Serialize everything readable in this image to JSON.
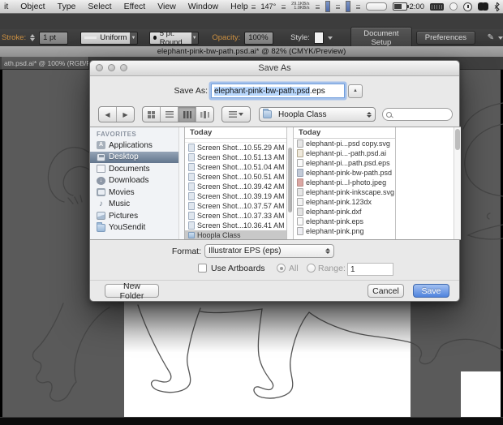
{
  "menubar": {
    "items": [
      "it",
      "Object",
      "Type",
      "Select",
      "Effect",
      "View",
      "Window",
      "Help"
    ],
    "status": {
      "temp": "147°",
      "net_up": "29.1KB/s",
      "net_down": "1.0KB/s",
      "battery_time": "2:00"
    }
  },
  "control_bar": {
    "stroke_label": "Stroke:",
    "stroke_value": "1 pt",
    "profile_value": "Uniform",
    "brush_value": "5 pt. Round",
    "opacity_label": "Opacity:",
    "opacity_value": "100%",
    "style_label": "Style:",
    "document_setup_label": "Document Setup",
    "preferences_label": "Preferences"
  },
  "document": {
    "title": "elephant-pink-bw-path.psd.ai* @ 82% (CMYK/Preview)",
    "tab": "ath.psd.ai* @ 100% (RGB/Previe"
  },
  "dialog": {
    "title": "Save As",
    "save_as_label": "Save As:",
    "filename_base": "elephant-pink-bw-path.psd",
    "filename_ext": ".eps",
    "location": "Hoopla Class",
    "sidebar": {
      "header": "FAVORITES",
      "items": [
        {
          "label": "Applications",
          "icon": "applications-icon"
        },
        {
          "label": "Desktop",
          "icon": "desktop-icon",
          "selected": true
        },
        {
          "label": "Documents",
          "icon": "documents-icon"
        },
        {
          "label": "Downloads",
          "icon": "downloads-icon"
        },
        {
          "label": "Movies",
          "icon": "movies-icon"
        },
        {
          "label": "Music",
          "icon": "music-icon"
        },
        {
          "label": "Pictures",
          "icon": "pictures-icon"
        },
        {
          "label": "YouSendit",
          "icon": "folder-icon"
        }
      ]
    },
    "column1": {
      "header": "Today",
      "files": [
        {
          "name": "Screen Shot...10.55.29 AM",
          "icon": "screenshot-icon"
        },
        {
          "name": "Screen Shot...10.51.13 AM",
          "icon": "screenshot-icon"
        },
        {
          "name": "Screen Shot...10.51.04 AM",
          "icon": "screenshot-icon"
        },
        {
          "name": "Screen Shot...10.50.51 AM",
          "icon": "screenshot-icon"
        },
        {
          "name": "Screen Shot...10.39.42 AM",
          "icon": "screenshot-icon"
        },
        {
          "name": "Screen Shot...10.39.19 AM",
          "icon": "screenshot-icon"
        },
        {
          "name": "Screen Shot...10.37.57 AM",
          "icon": "screenshot-icon"
        },
        {
          "name": "Screen Shot...10.37.33 AM",
          "icon": "screenshot-icon"
        },
        {
          "name": "Screen Shot...10.36.41 AM",
          "icon": "screenshot-icon"
        }
      ],
      "folder": "Hoopla Class"
    },
    "column2": {
      "header": "Today",
      "files": [
        {
          "name": "elephant-pi...psd copy.svg",
          "icon": "svg-doc-icon"
        },
        {
          "name": "elephant-pi...-path.psd.ai",
          "icon": "ai-doc-icon"
        },
        {
          "name": "elephant-pi...path.psd.eps",
          "icon": "eps-doc-icon"
        },
        {
          "name": "elephant-pink-bw-path.psd",
          "icon": "psd-doc-icon"
        },
        {
          "name": "elephant-pi...l-photo.jpeg",
          "icon": "jpeg-doc-icon"
        },
        {
          "name": "elephant-pink-inkscape.svg",
          "icon": "svg-doc-icon"
        },
        {
          "name": "elephant-pink.123dx",
          "icon": "generic-doc-icon"
        },
        {
          "name": "elephant-pink.dxf",
          "icon": "dxf-doc-icon"
        },
        {
          "name": "elephant-pink.eps",
          "icon": "eps-doc-icon"
        },
        {
          "name": "elephant-pink.png",
          "icon": "png-doc-icon"
        }
      ]
    },
    "format": {
      "label": "Format:",
      "value": "Illustrator EPS (eps)",
      "use_artboards_label": "Use Artboards",
      "all_label": "All",
      "range_label": "Range:",
      "range_value": "1"
    },
    "buttons": {
      "new_folder": "New Folder",
      "cancel": "Cancel",
      "save": "Save"
    }
  },
  "colors": {
    "save_button_blue": "#4f83dd",
    "selection_blue": "#b8d7fd",
    "sidebar_selection": "#62758d",
    "accent_orange": "#cf9242",
    "pasteboard_gray": "#5a5a5a"
  }
}
